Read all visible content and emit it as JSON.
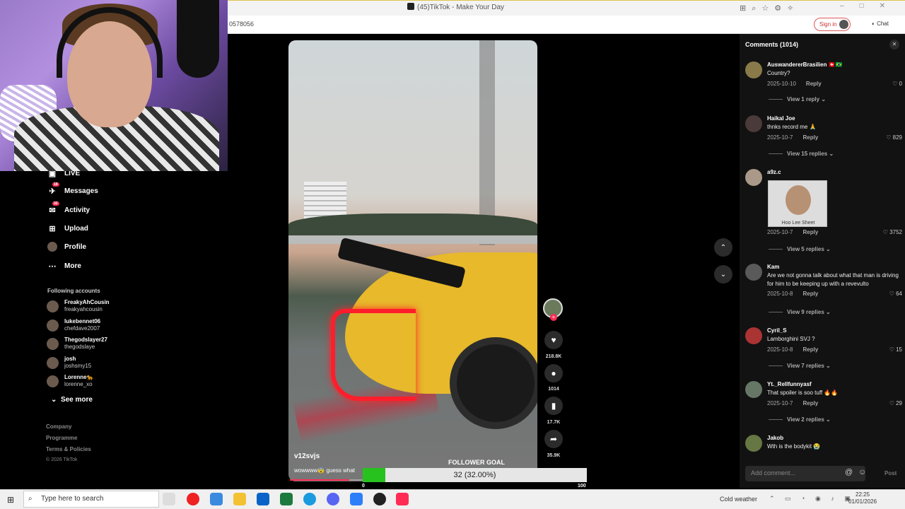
{
  "browser": {
    "tab_title": "(45)TikTok - Make Your Day",
    "url_fragment": "0578056",
    "signin_label": "Sign in",
    "chat_label": "Chat"
  },
  "nav": {
    "live": "LIVE",
    "messages": "Messages",
    "messages_badge": "18",
    "activity": "Activity",
    "activity_badge": "32",
    "upload": "Upload",
    "profile": "Profile",
    "more": "More",
    "following_heading": "Following accounts",
    "following": [
      {
        "name": "FreakyAhCousin",
        "handle": "freakyahcousin"
      },
      {
        "name": "lukebennet06",
        "handle": "chefdave2007"
      },
      {
        "name": "Thegodslayer27",
        "handle": "thegodslaye"
      },
      {
        "name": "josh",
        "handle": "joshsmy15"
      },
      {
        "name": "Lorenne🐆",
        "handle": "lorenne_xo"
      }
    ],
    "see_more": "See more",
    "footer": [
      "Company",
      "Programme",
      "Terms & Policies",
      "© 2026 TikTok"
    ]
  },
  "video": {
    "author": "v12svjs",
    "caption": "wowwww😨 guess what",
    "progress": 0.24,
    "likes": "218.8K",
    "comments": "1014",
    "saves": "17.7K",
    "shares": "35.9K"
  },
  "goal": {
    "title": "FOLLOWER GOAL",
    "current": 32,
    "target": 100,
    "min_label": "0",
    "max_label": "100",
    "text": "32 (32.00%)"
  },
  "comments": {
    "title": "Comments (1014)",
    "items": [
      {
        "user": "AuswandererBrasilien 🇨🇭🇧🇷",
        "text": "Country?",
        "date": "2025-10-10",
        "likes": "0",
        "view": "View 1 reply"
      },
      {
        "user": "Haikal Joe",
        "text": "thnks record me 🙏",
        "date": "2025-10-7",
        "likes": "829",
        "view": "View 15 replies"
      },
      {
        "user": "a9z.c",
        "text": "",
        "image_caption": "Hoo Lee Sheet",
        "date": "2025-10-7",
        "likes": "3752",
        "view": "View 5 replies"
      },
      {
        "user": "Kam",
        "text": "Are we not gonna talk about what that man is driving for him to be keeping up with a revevulto",
        "date": "2025-10-8",
        "likes": "64",
        "view": "View 9 replies"
      },
      {
        "user": "Cyril_S",
        "text": "Lamborghini SVJ ?",
        "date": "2025-10-8",
        "likes": "15",
        "view": "View 7 replies"
      },
      {
        "user": "Yt._Rellfunnyasf",
        "text": "That spoiler is soo tuff 🔥🔥",
        "date": "2025-10-7",
        "likes": "29",
        "view": "View 2 replies"
      },
      {
        "user": "Jakob",
        "text": "Wth is the bodykit 😭",
        "date": "",
        "likes": "",
        "view": ""
      }
    ],
    "reply_label": "Reply",
    "add_placeholder": "Add comment...",
    "post_label": "Post"
  },
  "taskbar": {
    "search_placeholder": "Type here to search",
    "weather": "Cold weather",
    "time": "22:25",
    "date": "01/01/2026"
  },
  "colors": {
    "accent": "#fe2c55",
    "goal_fill": "#28c21f"
  }
}
